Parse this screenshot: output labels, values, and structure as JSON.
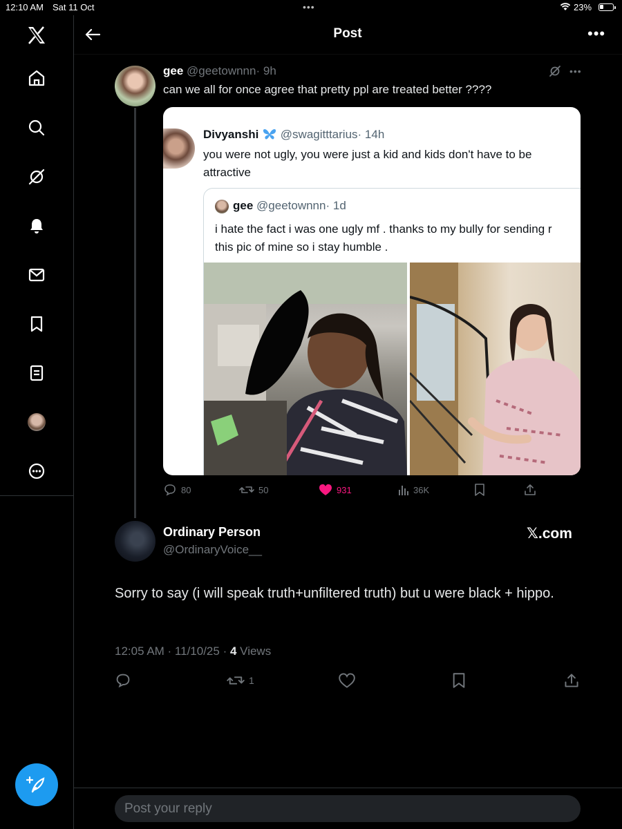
{
  "status_bar": {
    "time": "12:10 AM",
    "date": "Sat 11 Oct",
    "battery": "23%"
  },
  "header": {
    "title": "Post"
  },
  "sidebar": {
    "items": [
      "x-logo",
      "home-icon",
      "search-icon",
      "grok-icon",
      "notifications-icon",
      "messages-icon",
      "bookmarks-icon",
      "lists-icon",
      "profile-avatar",
      "more-icon"
    ]
  },
  "main_tweet": {
    "name": "gee",
    "handle": "@geetownnn",
    "time": "· 9h",
    "text": "can we all for once agree that pretty ppl are treated better ????",
    "quoted": {
      "name": "Divyanshi",
      "handle": "@swagitttarius",
      "time": "· 14h",
      "text": "you were not ugly, you were just a kid and kids don't have to be attractive",
      "quoted": {
        "name": "gee",
        "handle": "@geetownnn",
        "time": "· 1d",
        "text": "i hate the fact i was one ugly mf . thanks to my bully for sending r\nthis pic of mine so i stay humble ."
      }
    },
    "stats": {
      "replies": "80",
      "reposts": "50",
      "likes": "931",
      "views": "36K"
    }
  },
  "reply": {
    "name": "Ordinary Person",
    "handle": "@OrdinaryVoice__",
    "source": "𝕏.com",
    "text": "Sorry to say (i will speak truth+unfiltered truth) but u were black + hippo.",
    "timestamp": "12:05 AM · 11/10/25 · ",
    "views_count": "4",
    "views_label": " Views",
    "reposts": "1"
  },
  "reply_box": {
    "placeholder": "Post your reply"
  },
  "colors": {
    "accent": "#1d9bf0",
    "like": "#f91880",
    "background": "#000000"
  }
}
